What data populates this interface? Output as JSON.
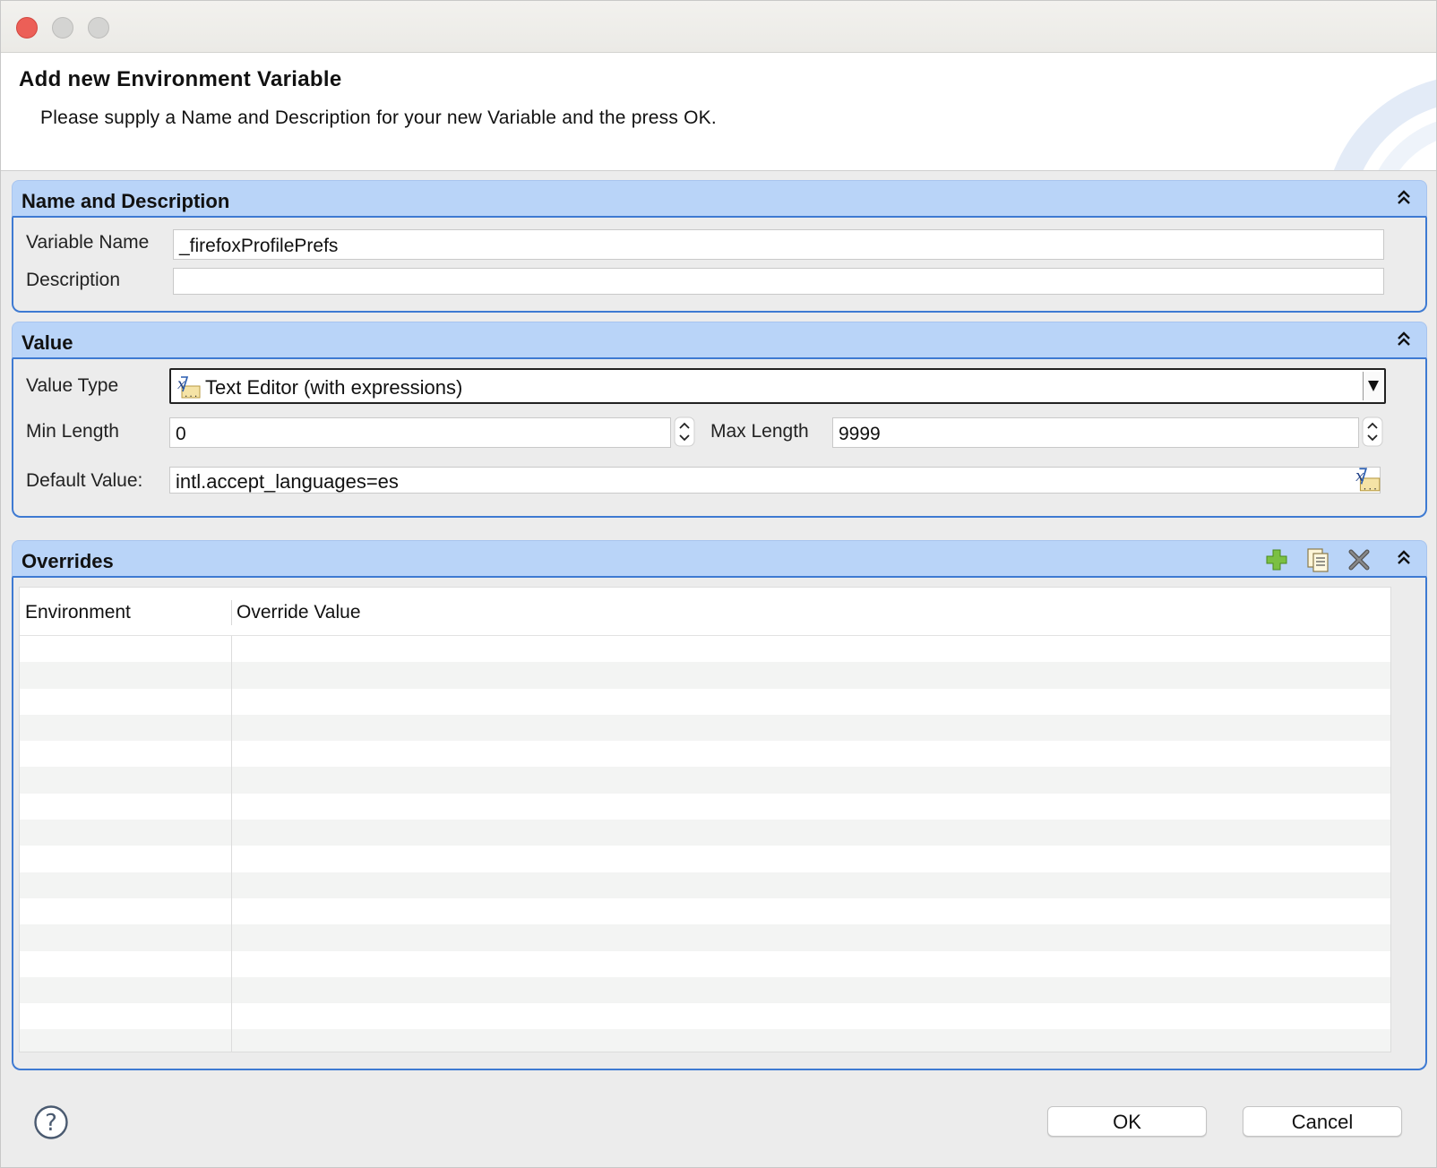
{
  "header": {
    "title": "Add new Environment Variable",
    "description": "Please supply a Name and Description for your new Variable and the press OK."
  },
  "name_section": {
    "title": "Name and Description",
    "variable_name_label": "Variable Name",
    "variable_name_value": "_firefoxProfilePrefs",
    "description_label": "Description",
    "description_value": ""
  },
  "value_section": {
    "title": "Value",
    "value_type_label": "Value Type",
    "value_type_selected": "Text Editor (with expressions)",
    "min_length_label": "Min Length",
    "min_length_value": "0",
    "max_length_label": "Max Length",
    "max_length_value": "9999",
    "default_value_label": "Default Value:",
    "default_value_value": "intl.accept_languages=es"
  },
  "overrides_section": {
    "title": "Overrides",
    "columns": [
      "Environment",
      "Override Value"
    ]
  },
  "footer": {
    "ok_label": "OK",
    "cancel_label": "Cancel"
  },
  "colors": {
    "section_header_bg": "#b9d4f8",
    "section_border": "#3e7ad2",
    "close_light": "#ec5f57"
  },
  "icons": {
    "collapse": "double-chevron-up-icon",
    "add": "plus-icon",
    "duplicate": "copy-icon",
    "delete": "delete-x-icon",
    "expression_editor": "expression-editor-icon",
    "help": "question-mark-icon"
  }
}
